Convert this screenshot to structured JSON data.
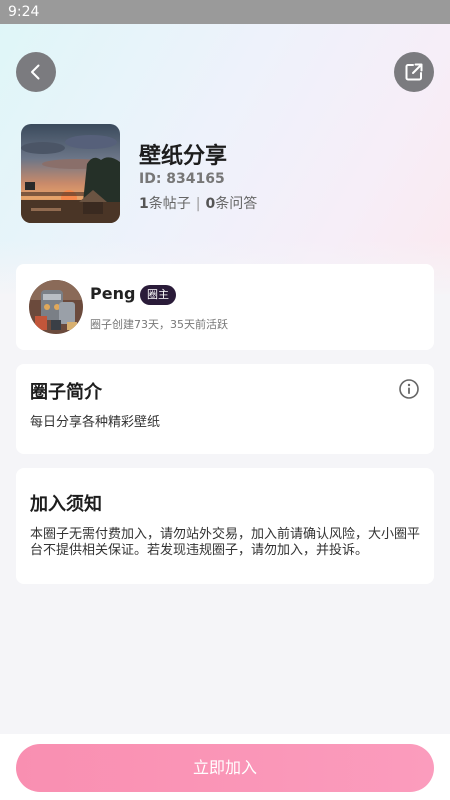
{
  "status_bar": {
    "time": "9:24"
  },
  "group": {
    "name": "壁纸分享",
    "id_text": "ID: 834165",
    "posts_count": "1",
    "posts_label": "条帖子",
    "separator": "|",
    "answers_count": "0",
    "answers_label": "条问答"
  },
  "owner": {
    "name": "Peng",
    "badge": "圈主",
    "meta": "圈子创建73天，35天前活跃"
  },
  "intro": {
    "title": "圈子简介",
    "text": "每日分享各种精彩壁纸"
  },
  "rules": {
    "title": "加入须知",
    "text": "本圈子无需付费加入，请勿站外交易，加入前请确认风险，大小圈平台不提供相关保证。若发现违规圈子，请勿加入，并投诉。"
  },
  "actions": {
    "join_label": "立即加入"
  },
  "icons": {
    "back": "chevron-left-icon",
    "share": "share-external-icon",
    "info": "info-circle-icon"
  },
  "colors": {
    "accent": "#fb96b8",
    "badge_bg": "#2a1b39",
    "icon_btn_bg": "#7b7b7f"
  }
}
